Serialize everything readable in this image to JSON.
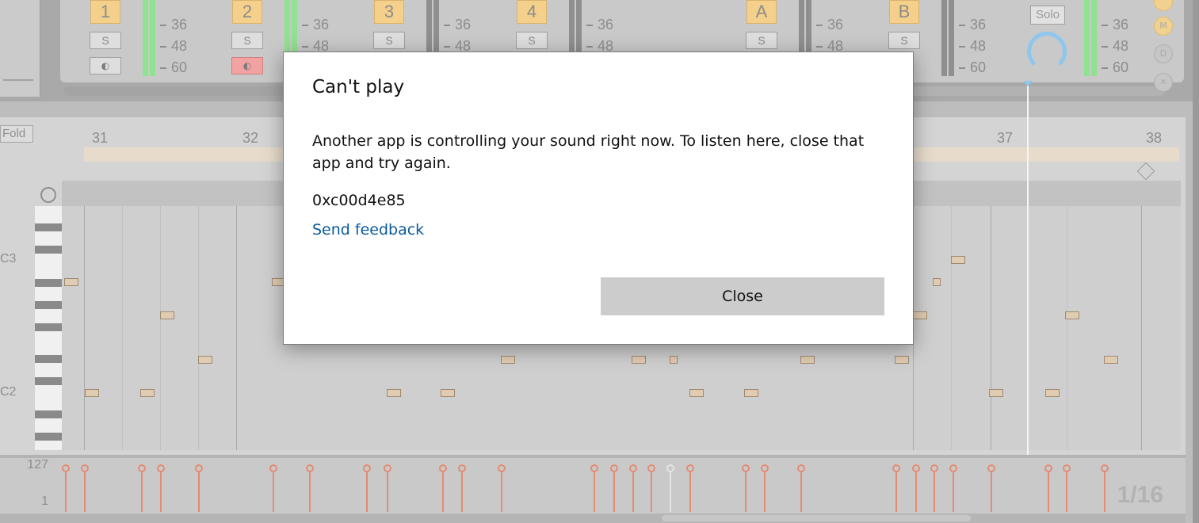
{
  "dialog": {
    "title": "Can't play",
    "message": "Another app is controlling your sound right now. To listen here, close that app and try again.",
    "error_code": "0xc00d4e85",
    "feedback_link": "Send feedback",
    "close_button": "Close"
  },
  "mixer": {
    "tracks": [
      {
        "label": "1",
        "solo": "S"
      },
      {
        "label": "2",
        "solo": "S"
      },
      {
        "label": "3",
        "solo": "S"
      },
      {
        "label": "4",
        "solo": "S"
      },
      {
        "label": "A",
        "solo": "S"
      },
      {
        "label": "B",
        "solo": "S"
      }
    ],
    "scale": [
      "36",
      "48",
      "60"
    ],
    "master_solo": "Solo"
  },
  "piano_roll": {
    "fold_label": "Fold",
    "bars": [
      "31",
      "32",
      "37",
      "38"
    ],
    "key_labels": [
      "C3",
      "C2"
    ],
    "velocity_max": "127",
    "velocity_min": "1",
    "quantize": "1/16"
  },
  "colors": {
    "dialog_link": "#0a5a9c",
    "close_button_bg": "#cccccc",
    "track_badge": "#f4d08a",
    "velocity_stem": "#e58b73"
  }
}
